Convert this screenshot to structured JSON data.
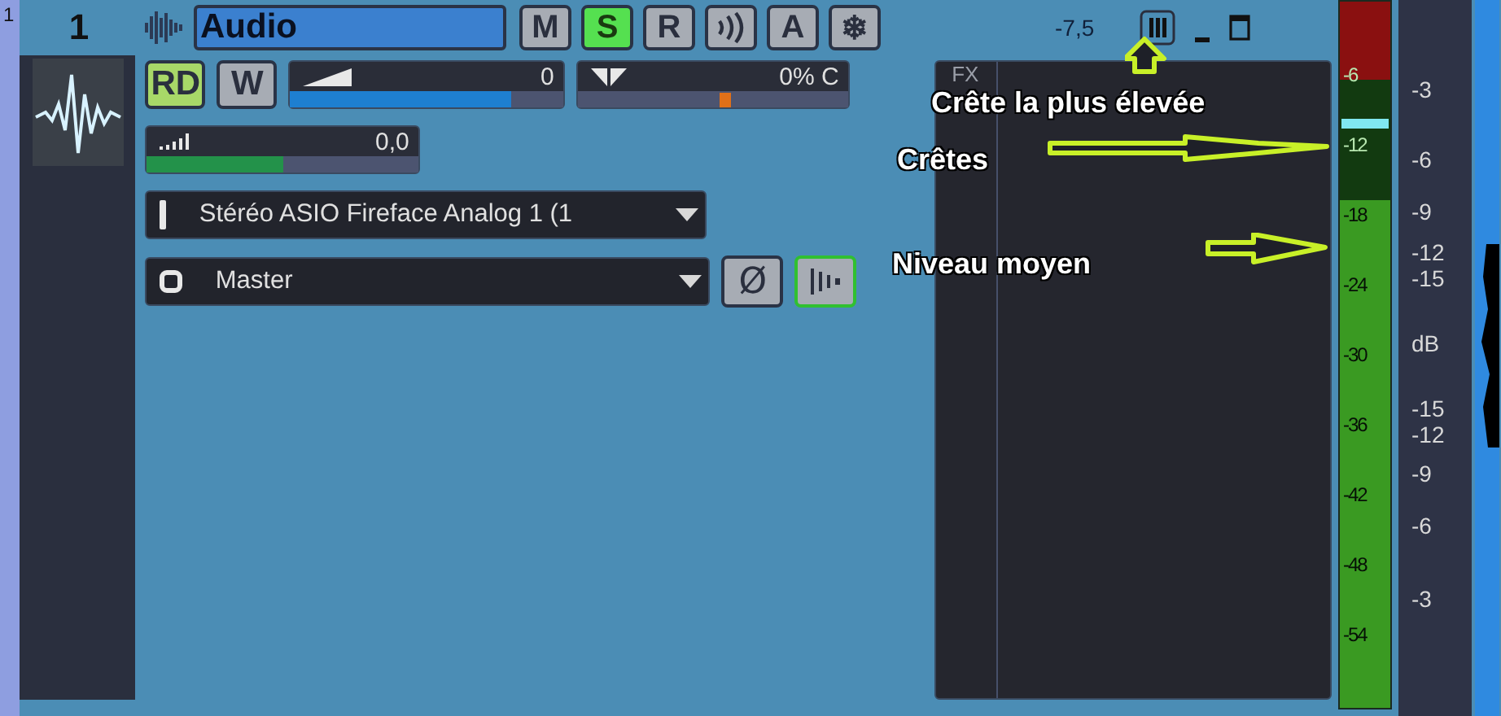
{
  "lane_number": "1",
  "track": {
    "number": "1",
    "name": "Audio",
    "reading": "-7,5"
  },
  "track_buttons": [
    {
      "kind": "text",
      "label": "M",
      "selected": false
    },
    {
      "kind": "text",
      "label": "S",
      "selected": true
    },
    {
      "kind": "text",
      "label": "R",
      "selected": false
    },
    {
      "kind": "waves",
      "selected": false
    },
    {
      "kind": "text",
      "label": "A",
      "selected": false
    },
    {
      "kind": "text",
      "label": "❄",
      "selected": false
    }
  ],
  "mode_buttons": [
    {
      "label": "RD",
      "selected": true
    },
    {
      "label": "W",
      "selected": false
    }
  ],
  "volume": {
    "value": "0",
    "level": 0.81
  },
  "pan": {
    "value": "0% C",
    "level": 0.52
  },
  "trim": {
    "value": "0,0",
    "level": 0.5
  },
  "input": {
    "value": "Stéréo ASIO Fireface Analog 1 (1"
  },
  "output": {
    "value": "Master"
  },
  "phase": {
    "label": "Ø",
    "selected": false
  },
  "interleave": {
    "selected": true
  },
  "fx": {
    "label": "FX"
  },
  "meter": {
    "ticks": [
      "-6",
      "-12",
      "-18",
      "-24",
      "-30",
      "-36",
      "-42",
      "-48",
      "-54"
    ],
    "level": 0.72
  },
  "scale": [
    "-3",
    "-6",
    "-9",
    "-12",
    "-15",
    "dB",
    "-15",
    "-12",
    "-9",
    "-6",
    "-3"
  ],
  "annotations": [
    {
      "text": "Crête la plus élevée"
    },
    {
      "text": "Crêtes"
    },
    {
      "text": "Niveau moyen"
    }
  ]
}
